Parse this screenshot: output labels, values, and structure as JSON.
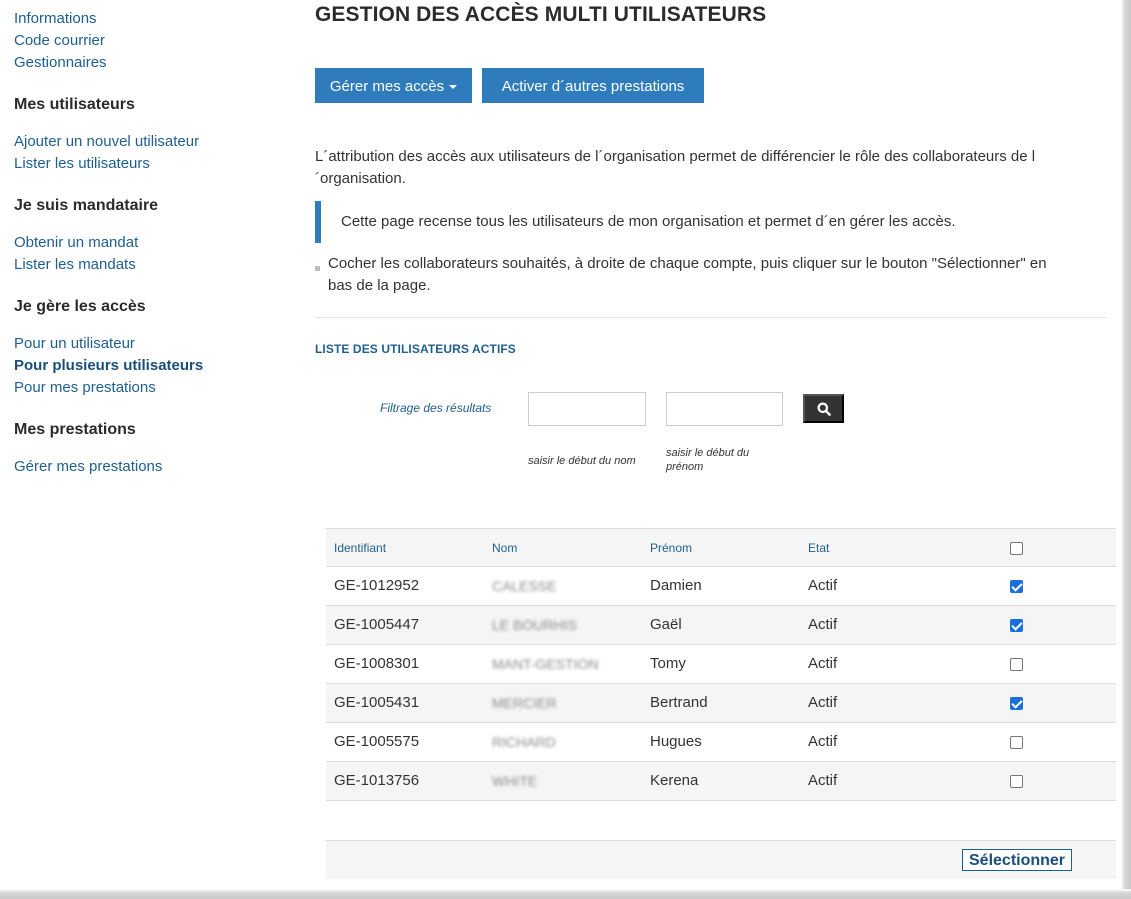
{
  "sidebar": {
    "top_links": [
      "Informations",
      "Code courrier",
      "Gestionnaires"
    ],
    "sections": [
      {
        "heading": "Mes utilisateurs",
        "links": [
          "Ajouter un nouvel utilisateur",
          "Lister les utilisateurs"
        ]
      },
      {
        "heading": "Je suis mandataire",
        "links": [
          "Obtenir un mandat",
          "Lister les mandats"
        ]
      },
      {
        "heading": "Je gère les accès",
        "links": [
          "Pour un utilisateur",
          "Pour plusieurs utilisateurs",
          "Pour mes prestations"
        ]
      },
      {
        "heading": "Mes prestations",
        "links": [
          "Gérer mes prestations"
        ]
      }
    ],
    "active_link": "Pour plusieurs utilisateurs"
  },
  "main": {
    "title": "GESTION DES ACCÈS MULTI UTILISATEURS",
    "btn_manage": "Gérer mes accès",
    "btn_activate": "Activer d´autres prestations",
    "intro_line1": "L´attribution des accès aux utilisateurs de l´organisation permet de différencier le rôle des collaborateurs de l",
    "intro_line2": "´organisation.",
    "quote": "Cette page recense tous les utilisateurs de mon organisation et permet d´en gérer les accès.",
    "bullet_line1": "Cocher les collaborateurs souhaités, à droite de chaque compte, puis cliquer sur le bouton \"Sélectionner\" en",
    "bullet_line2": "bas de la page.",
    "list_title": "LISTE DES UTILISATEURS ACTIFS",
    "filter_label": "Filtrage des résultats",
    "hint_nom": "saisir le début du nom",
    "hint_prenom_1": "saisir le début du",
    "hint_prenom_2": "prénom",
    "table": {
      "headers": [
        "Identifiant",
        "Nom",
        "Prénom",
        "Etat"
      ],
      "select_all_checked": false,
      "rows": [
        {
          "id": "GE-1012952",
          "nom": "CALESSE",
          "prenom": "Damien",
          "etat": "Actif",
          "checked": true
        },
        {
          "id": "GE-1005447",
          "nom": "LE BOURHIS",
          "prenom": "Gaël",
          "etat": "Actif",
          "checked": true
        },
        {
          "id": "GE-1008301",
          "nom": "MANT-GESTION",
          "prenom": "Tomy",
          "etat": "Actif",
          "checked": false
        },
        {
          "id": "GE-1005431",
          "nom": "MERCIER",
          "prenom": "Bertrand",
          "etat": "Actif",
          "checked": true
        },
        {
          "id": "GE-1005575",
          "nom": "RICHARD",
          "prenom": "Hugues",
          "etat": "Actif",
          "checked": false
        },
        {
          "id": "GE-1013756",
          "nom": "WHITE",
          "prenom": "Kerena",
          "etat": "Actif",
          "checked": false
        }
      ]
    },
    "select_button": "Sélectionner"
  },
  "colors": {
    "accent": "#2f7cbd",
    "link": "#1f5f8f",
    "checkbox_on": "#1a6fdb"
  },
  "icons": {
    "search": "search-icon",
    "dropdown": "caret-down-icon"
  }
}
